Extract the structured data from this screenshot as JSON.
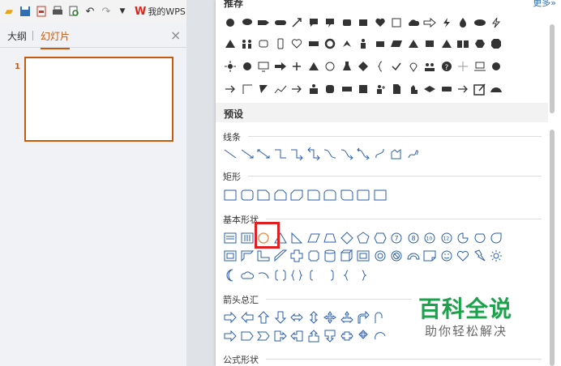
{
  "toolbar": {
    "buttons": [
      "folder-open-icon",
      "save-icon",
      "export-pdf-icon",
      "print-icon",
      "print-preview-icon",
      "undo-icon",
      "redo-icon",
      "dropdown-arrow-icon"
    ],
    "wps_label": "我的WPS"
  },
  "left_pane": {
    "tabs": [
      {
        "label": "大纲"
      },
      {
        "label": "幻灯片"
      }
    ],
    "active_tab": "幻灯片",
    "slides": [
      {
        "number": "1"
      }
    ]
  },
  "shapes_panel": {
    "recent_title": "推荐",
    "more_label": "更多»",
    "preset_title": "预设",
    "groups": [
      {
        "label": "线条"
      },
      {
        "label": "矩形"
      },
      {
        "label": "基本形状"
      },
      {
        "label": "箭头总汇"
      },
      {
        "label": "公式形状"
      }
    ],
    "highlighted_shape": "oval-shape"
  },
  "watermark": {
    "title": "百科全说",
    "subtitle": "助你轻松解决"
  },
  "colors": {
    "accent": "#c55a11",
    "highlight": "#e02020",
    "watermark": "#1aa34a",
    "shape_stroke": "#2b5ea8"
  }
}
